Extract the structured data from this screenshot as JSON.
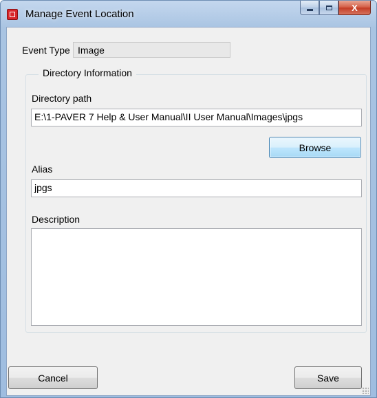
{
  "window": {
    "title": "Manage Event Location",
    "minimize_icon": "minimize-icon",
    "maximize_icon": "maximize-icon",
    "close_glyph": "X"
  },
  "event_type": {
    "label": "Event Type",
    "value": "Image"
  },
  "directory_group": {
    "legend": "Directory Information",
    "path_label": "Directory path",
    "path_value": "E:\\1-PAVER 7 Help & User Manual\\II User Manual\\Images\\jpgs",
    "browse_label": "Browse",
    "alias_label": "Alias",
    "alias_value": "jpgs",
    "description_label": "Description",
    "description_value": ""
  },
  "footer": {
    "cancel_label": "Cancel",
    "save_label": "Save"
  }
}
